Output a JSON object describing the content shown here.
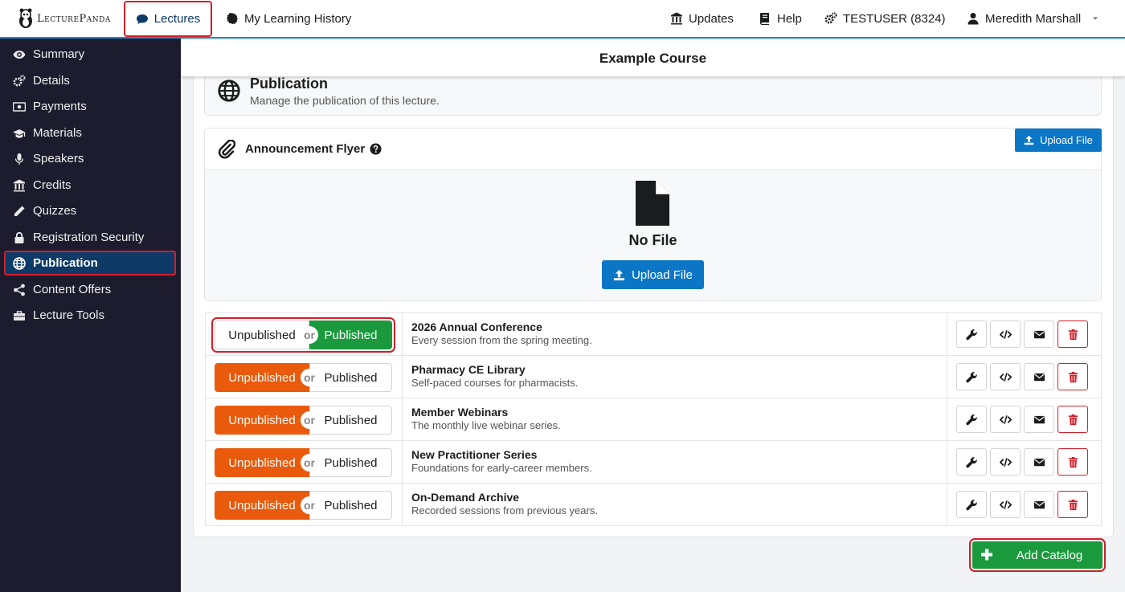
{
  "brand": {
    "name": "LecturePanda"
  },
  "topnav": {
    "lectures": "Lectures",
    "history": "My Learning History",
    "updates": "Updates",
    "help": "Help",
    "account": "TESTUSER (8324)",
    "user": "Meredith Marshall"
  },
  "sidebar": {
    "items": [
      {
        "label": "Summary",
        "icon": "eye-icon"
      },
      {
        "label": "Details",
        "icon": "gears-icon"
      },
      {
        "label": "Payments",
        "icon": "money-icon"
      },
      {
        "label": "Materials",
        "icon": "graduation-cap-icon"
      },
      {
        "label": "Speakers",
        "icon": "microphone-icon"
      },
      {
        "label": "Credits",
        "icon": "institution-icon"
      },
      {
        "label": "Quizzes",
        "icon": "pencil-icon"
      },
      {
        "label": "Registration Security",
        "icon": "lock-icon"
      },
      {
        "label": "Publication",
        "icon": "globe-icon"
      },
      {
        "label": "Content Offers",
        "icon": "share-icon"
      },
      {
        "label": "Lecture Tools",
        "icon": "toolbox-icon"
      }
    ],
    "active": "Publication"
  },
  "page": {
    "course_title": "Example Course"
  },
  "publication": {
    "title": "Publication",
    "description": "Manage the publication of this lecture."
  },
  "flyer": {
    "title": "Announcement Flyer",
    "upload_top": "Upload File",
    "no_file": "No File",
    "upload_main": "Upload File"
  },
  "toggle_labels": {
    "unpublished": "Unpublished",
    "or": "or",
    "published": "Published"
  },
  "catalogs": [
    {
      "name": "2026 Annual Conference",
      "description": "Every session from the spring meeting.",
      "status": "Published"
    },
    {
      "name": "Pharmacy CE Library",
      "description": "Self-paced courses for pharmacists.",
      "status": "Unpublished"
    },
    {
      "name": "Member Webinars",
      "description": "The monthly live webinar series.",
      "status": "Unpublished"
    },
    {
      "name": "New Practitioner Series",
      "description": "Foundations for early-career members.",
      "status": "Unpublished"
    },
    {
      "name": "On-Demand Archive",
      "description": "Recorded sessions from previous years.",
      "status": "Unpublished"
    }
  ],
  "add_catalog": "Add Catalog",
  "colors": {
    "primary": "#0b76c5",
    "nav_active": "#0d3a66",
    "sidebar_bg": "#1c1c2e",
    "published": "#1a9a3d",
    "unpublished": "#e95a0c",
    "danger": "#d21f2a"
  }
}
